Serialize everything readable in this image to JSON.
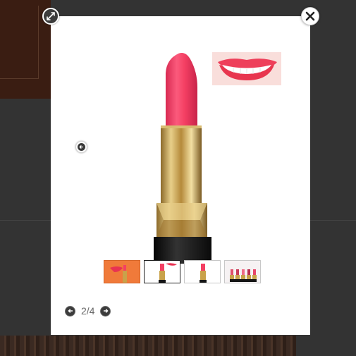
{
  "background": {
    "dim_color": "#333333"
  },
  "modal": {
    "background_color": "#ffffff",
    "expand_icon": "expand-icon",
    "close_icon": "close-icon",
    "prev_icon": "arrow-left-icon",
    "thumbnails": [
      {
        "name": "thumb-lips-orange",
        "selected": false
      },
      {
        "name": "thumb-lipstick-single",
        "selected": true
      },
      {
        "name": "thumb-lipstick-alt",
        "selected": false
      },
      {
        "name": "thumb-lipstick-set",
        "selected": false
      }
    ],
    "pager": {
      "counter": "2/4",
      "prev_icon": "arrow-left-icon",
      "next_icon": "arrow-right-icon"
    },
    "colors": {
      "lipstick_pink": "#f43f63",
      "gold": "#c9a24a",
      "case_black": "#151515"
    }
  }
}
